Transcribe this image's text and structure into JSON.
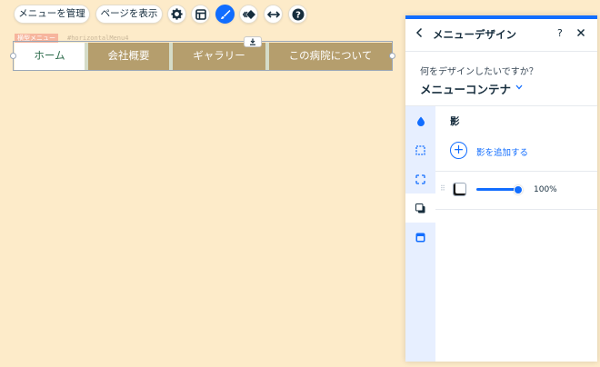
{
  "toolbar": {
    "manage_menu": "メニューを管理",
    "show_pages": "ページを表示",
    "icons": [
      "gear-icon",
      "layout-icon",
      "design-brush-icon",
      "animation-icon",
      "stretch-icon",
      "help-icon"
    ]
  },
  "menu": {
    "type_label": "横型メニュー",
    "element_id": "#horizontalMenu4",
    "items": [
      "ホーム",
      "会社概要",
      "ギャラリー",
      "この病院について"
    ],
    "selected_color": "#ffffff",
    "item_color": "#b59e6d"
  },
  "panel": {
    "title": "メニューデザイン",
    "help": "?",
    "question": "何をデザインしたいですか？",
    "target": "メニューコンテナ",
    "section_title": "影",
    "add_shadow": "影を追加する",
    "shadow_opacity": "100%",
    "shadow_opacity_value": 1.0,
    "accent_color": "#116dff",
    "sidebar_icons": [
      "fill-icon",
      "border-icon",
      "corners-icon",
      "shadow-icon",
      "layout-icon"
    ],
    "selected_sidebar": "shadow-icon"
  }
}
